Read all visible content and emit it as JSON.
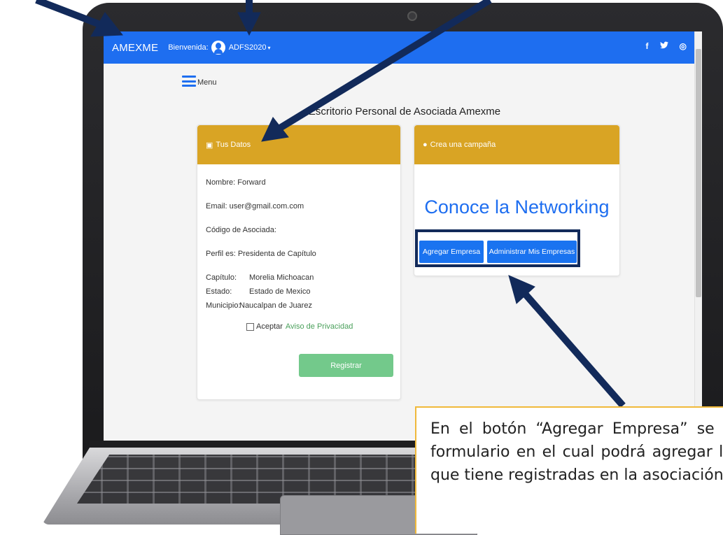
{
  "navbar": {
    "brand": "AMEXME",
    "welcome_label": "Bienvenida:",
    "username": "ADFS2020",
    "caret": "▾",
    "social": [
      "f",
      "🐦",
      "◎"
    ]
  },
  "menu": {
    "label": "Menu"
  },
  "page_title": "Escritorio Personal de Asociada Amexme",
  "datos_card": {
    "header": "Tus Datos",
    "lines": [
      "Nombre: Forward",
      "Email: user@gmail.com.com",
      "Código de Asociada:",
      "Perfil es: Presidenta de Capítulo"
    ],
    "rows": [
      {
        "key": "Capítulo:",
        "value": "Morelia Michoacan"
      },
      {
        "key": "Estado:",
        "value": "Estado de Mexico"
      },
      {
        "key": "Municipio:",
        "value": "Naucalpan de Juarez"
      }
    ],
    "privacy_prefix": "Aceptar",
    "privacy_link": "Aviso de Privacidad",
    "register_button": "Registrar"
  },
  "campana_card": {
    "header": "Crea una campaña",
    "headline": "Conoce la Networking",
    "add_button": "Agregar Empresa",
    "admin_button": "Administrar Mis Empresas"
  },
  "callout": {
    "text": "En el botón “Agregar Empresa” se mostrará un formulario en el cual podrá agregar las empresas que tiene registradas en la asociación."
  },
  "colors": {
    "navbar": "#1e6ef0",
    "card_header": "#d9a424",
    "register_button": "#73c98b",
    "primary_button": "#1a73f0",
    "arrow": "#122a5a",
    "callout_border": "#f0b93a"
  }
}
